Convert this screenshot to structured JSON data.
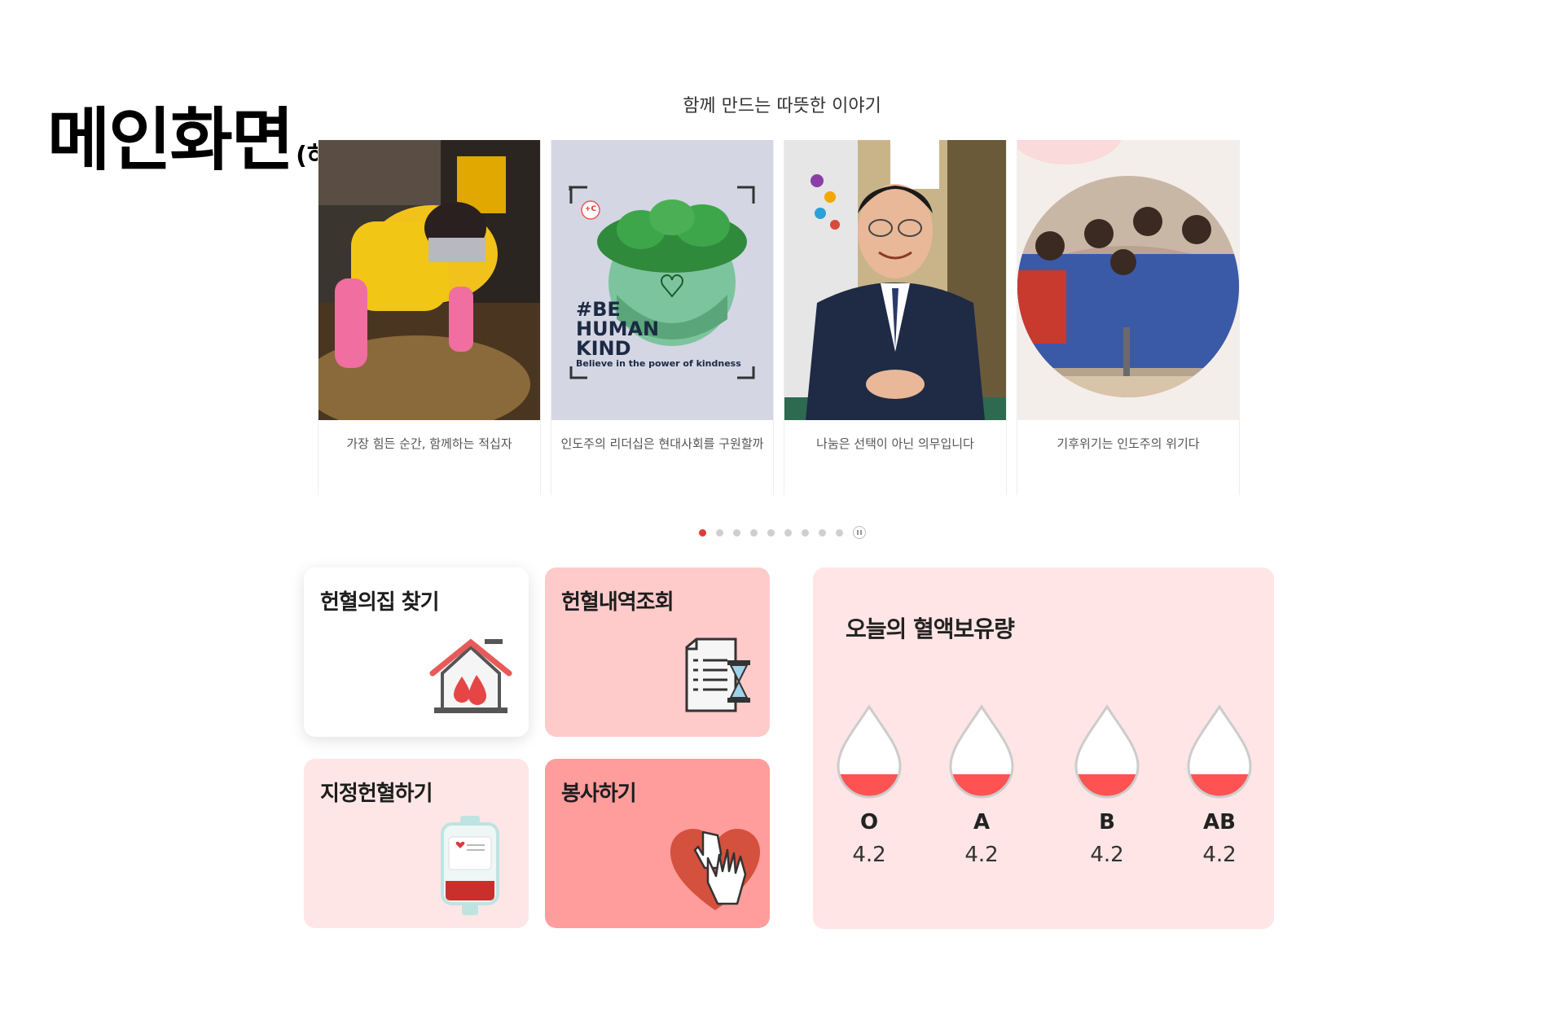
{
  "page_heading": {
    "main": "메인화면",
    "sub": "(하)"
  },
  "stories": {
    "title": "함께 만드는 따뜻한 이야기",
    "cards": [
      {
        "caption": "가장 힘든 순간, 함께하는 적십자",
        "image": "volunteer-photo"
      },
      {
        "caption": "인도주의 리더십은 현대사회를 구원할까",
        "image": "be-human-kind-poster",
        "poster_lines": [
          "#BE",
          "HUMAN",
          "KIND"
        ],
        "poster_tagline": "Believe in the power of kindness",
        "poster_badge": "+C"
      },
      {
        "caption": "나눔은 선택이 아닌 의무입니다",
        "image": "portrait-photo"
      },
      {
        "caption": "기후위기는 인도주의 위기다",
        "image": "children-water-photo"
      }
    ],
    "pagination": {
      "total": 9,
      "active": 1
    }
  },
  "menu": {
    "find_donation_house": {
      "label": "헌혈의집 찾기",
      "icon": "blood-house-icon"
    },
    "donation_history": {
      "label": "헌혈내역조회",
      "icon": "document-hourglass-icon"
    },
    "designated_donation": {
      "label": "지정헌혈하기",
      "icon": "blood-bag-icon"
    },
    "volunteer": {
      "label": "봉사하기",
      "icon": "heart-hands-icon"
    }
  },
  "blood_stock": {
    "title": "오늘의 혈액보유량",
    "items": [
      {
        "type": "O",
        "value": "4.2"
      },
      {
        "type": "A",
        "value": "4.2"
      },
      {
        "type": "B",
        "value": "4.2"
      },
      {
        "type": "AB",
        "value": "4.2"
      }
    ],
    "fill_color": "#ff5252"
  },
  "colors": {
    "accent": "#e03a3a",
    "tile_pink": "#ffcaca",
    "tile_light": "#ffe6e6",
    "tile_salmon": "#ff9c9c",
    "panel": "#ffe5e5"
  }
}
